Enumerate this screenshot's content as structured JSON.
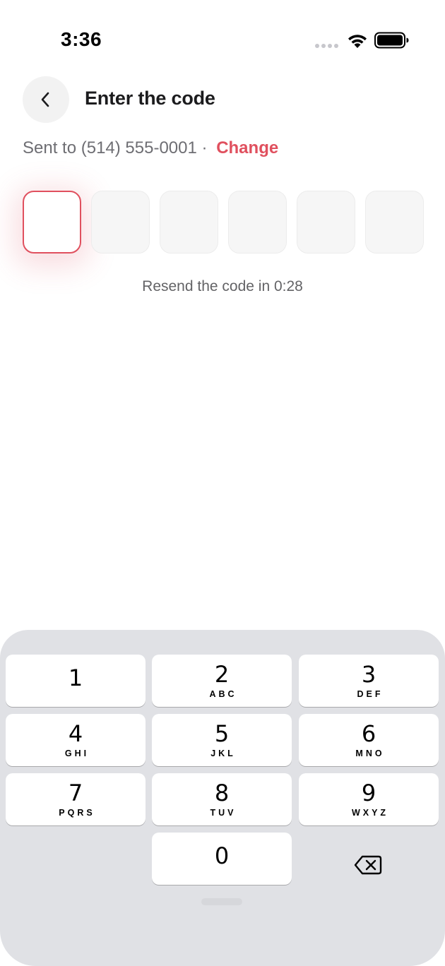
{
  "status_bar": {
    "time": "3:36",
    "icons": [
      "signal-dots-icon",
      "wifi-icon",
      "battery-icon"
    ]
  },
  "header": {
    "back_icon": "chevron-left-icon",
    "title": "Enter the code"
  },
  "sent_to": {
    "prefix": "Sent to (514) 555-0001 ·",
    "change_label": "Change"
  },
  "code": {
    "length": 6,
    "values": [
      "",
      "",
      "",
      "",
      "",
      ""
    ],
    "active_index": 0
  },
  "resend": {
    "text": "Resend the code in 0:28"
  },
  "keyboard": {
    "keys": [
      {
        "digit": "1",
        "letters": ""
      },
      {
        "digit": "2",
        "letters": "ABC"
      },
      {
        "digit": "3",
        "letters": "DEF"
      },
      {
        "digit": "4",
        "letters": "GHI"
      },
      {
        "digit": "5",
        "letters": "JKL"
      },
      {
        "digit": "6",
        "letters": "MNO"
      },
      {
        "digit": "7",
        "letters": "PQRS"
      },
      {
        "digit": "8",
        "letters": "TUV"
      },
      {
        "digit": "9",
        "letters": "WXYZ"
      },
      {
        "digit": "0",
        "letters": ""
      }
    ],
    "delete_icon": "backspace-icon"
  },
  "colors": {
    "accent": "#e0505e",
    "box_fill": "#f6f6f6",
    "keyboard_bg": "#e0e1e5"
  }
}
